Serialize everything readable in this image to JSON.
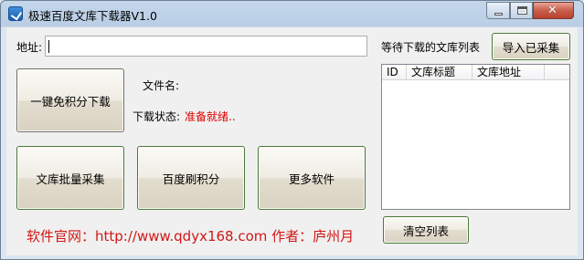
{
  "window": {
    "title": "极速百度文库下载器V1.0",
    "controls": {
      "minimize": "—",
      "maximize": "□",
      "close": "✕"
    }
  },
  "address": {
    "label": "地址:",
    "value": ""
  },
  "list": {
    "caption": "等待下载的文库列表",
    "columns": [
      "ID",
      "文库标题",
      "文库地址",
      ""
    ],
    "rows": []
  },
  "buttons": {
    "import": "导入已采集",
    "free_download": "一键免积分下载",
    "batch_collect": "文库批量采集",
    "baidu_points": "百度刷积分",
    "more_software": "更多软件",
    "clear_list": "清空列表"
  },
  "file": {
    "name_label": "文件名:",
    "name_value": ""
  },
  "status": {
    "label": "下载状态:",
    "value": "准备就绪.."
  },
  "footer": {
    "text": "软件官网：http://www.qdyx168.com 作者：庐州月"
  },
  "colors": {
    "status": "#e00000",
    "footer": "#d11616"
  }
}
